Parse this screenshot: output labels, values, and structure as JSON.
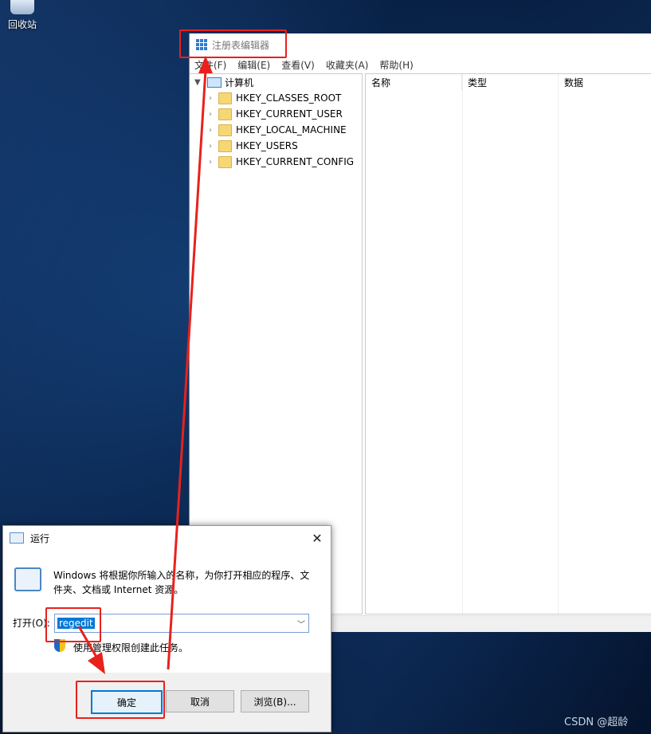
{
  "desktop": {
    "recycle_bin_label": "回收站",
    "watermark": "CSDN @超龄"
  },
  "regedit": {
    "title": "注册表编辑器",
    "menu": [
      "文件(F)",
      "编辑(E)",
      "查看(V)",
      "收藏夹(A)",
      "帮助(H)"
    ],
    "tree_root": "计算机",
    "tree_items": [
      "HKEY_CLASSES_ROOT",
      "HKEY_CURRENT_USER",
      "HKEY_LOCAL_MACHINE",
      "HKEY_USERS",
      "HKEY_CURRENT_CONFIG"
    ],
    "columns": [
      "名称",
      "类型",
      "数据"
    ]
  },
  "run_dialog": {
    "title": "运行",
    "close_glyph": "✕",
    "description": "Windows 将根据你所输入的名称，为你打开相应的程序、文件夹、文档或 Internet 资源。",
    "open_label": "打开(O):",
    "input_value": "regedit",
    "admin_text": "使用管理权限创建此任务。",
    "ok_label": "确定",
    "cancel_label": "取消",
    "browse_label": "浏览(B)..."
  },
  "colors": {
    "accent": "#0078d7",
    "annotation_red": "#e8211c",
    "desktop_bg": "#0b2a55"
  }
}
